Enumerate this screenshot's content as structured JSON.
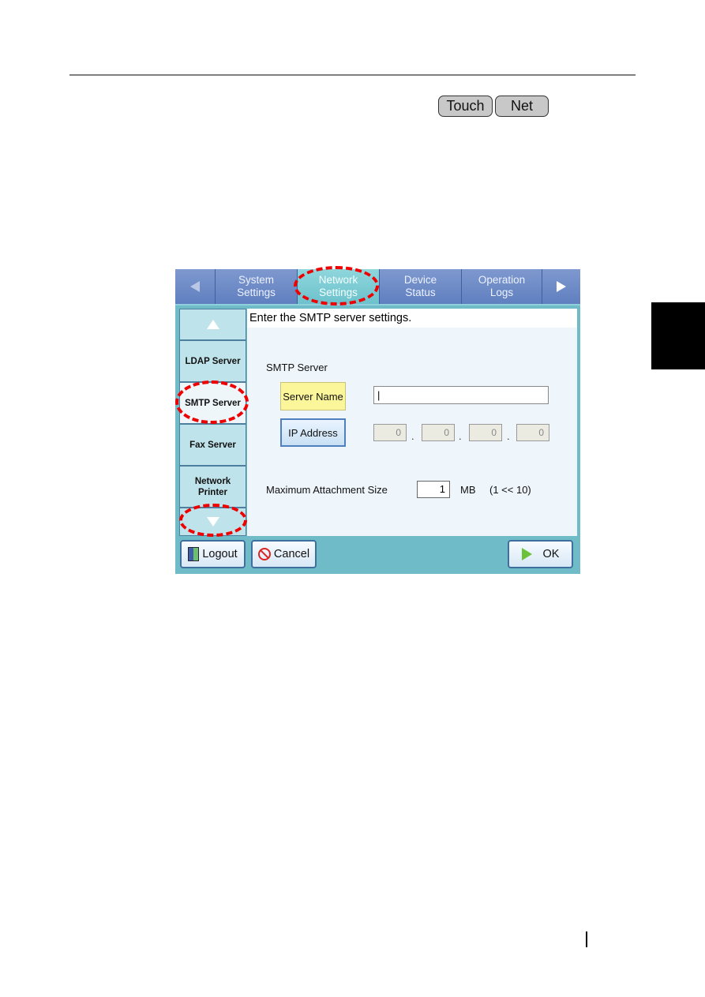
{
  "header": {
    "tags": [
      "Touch",
      "Net"
    ]
  },
  "screen": {
    "tabs": [
      {
        "label": "System\nSettings",
        "line1": "System",
        "line2": "Settings",
        "active": false
      },
      {
        "label": "Network\nSettings",
        "line1": "Network",
        "line2": "Settings",
        "active": true
      },
      {
        "label": "Device\nStatus",
        "line1": "Device",
        "line2": "Status",
        "active": false
      },
      {
        "label": "Operation\nLogs",
        "line1": "Operation",
        "line2": "Logs",
        "active": false
      }
    ],
    "sidebar": {
      "items": [
        {
          "label": "LDAP Server"
        },
        {
          "label": "SMTP Server",
          "selected": true
        },
        {
          "label": "Fax Server"
        },
        {
          "label": "Network",
          "label2": "Printer"
        }
      ]
    },
    "content": {
      "instruction": "Enter the SMTP server settings.",
      "section_title": "SMTP Server",
      "server_name_button": "Server Name",
      "ip_address_button": "IP Address",
      "server_name_value": "|",
      "ip_octets": [
        "0",
        "0",
        "0",
        "0"
      ],
      "ip_separator": ".",
      "max_attachment_label": "Maximum Attachment Size",
      "max_attachment_value": "1",
      "max_attachment_unit": "MB",
      "max_attachment_range": "(1 << 10)"
    },
    "buttons": {
      "logout": "Logout",
      "cancel": "Cancel",
      "ok": "OK"
    }
  }
}
